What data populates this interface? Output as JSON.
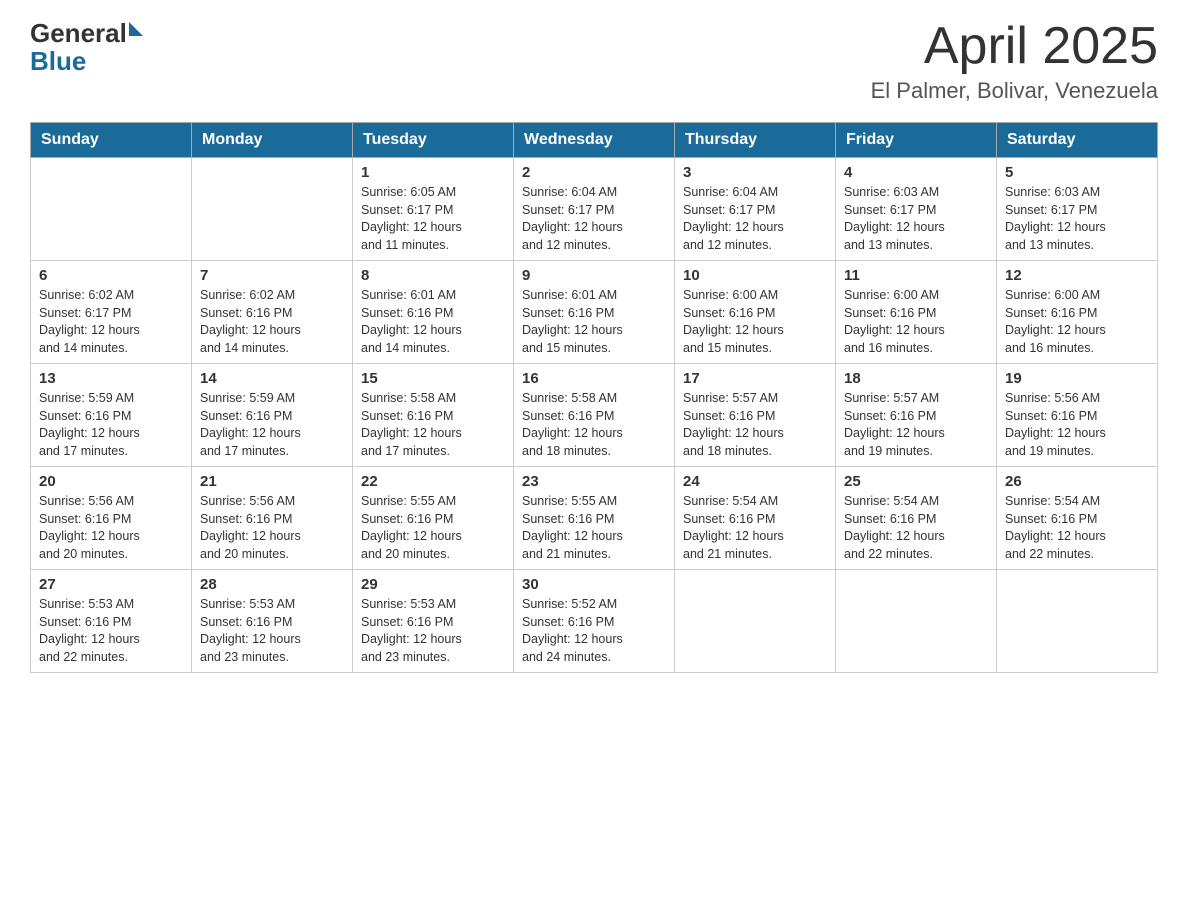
{
  "logo": {
    "general": "General",
    "blue": "Blue",
    "arrow": "▶"
  },
  "title": "April 2025",
  "subtitle": "El Palmer, Bolivar, Venezuela",
  "weekdays": [
    "Sunday",
    "Monday",
    "Tuesday",
    "Wednesday",
    "Thursday",
    "Friday",
    "Saturday"
  ],
  "weeks": [
    [
      {
        "day": "",
        "info": ""
      },
      {
        "day": "",
        "info": ""
      },
      {
        "day": "1",
        "info": "Sunrise: 6:05 AM\nSunset: 6:17 PM\nDaylight: 12 hours\nand 11 minutes."
      },
      {
        "day": "2",
        "info": "Sunrise: 6:04 AM\nSunset: 6:17 PM\nDaylight: 12 hours\nand 12 minutes."
      },
      {
        "day": "3",
        "info": "Sunrise: 6:04 AM\nSunset: 6:17 PM\nDaylight: 12 hours\nand 12 minutes."
      },
      {
        "day": "4",
        "info": "Sunrise: 6:03 AM\nSunset: 6:17 PM\nDaylight: 12 hours\nand 13 minutes."
      },
      {
        "day": "5",
        "info": "Sunrise: 6:03 AM\nSunset: 6:17 PM\nDaylight: 12 hours\nand 13 minutes."
      }
    ],
    [
      {
        "day": "6",
        "info": "Sunrise: 6:02 AM\nSunset: 6:17 PM\nDaylight: 12 hours\nand 14 minutes."
      },
      {
        "day": "7",
        "info": "Sunrise: 6:02 AM\nSunset: 6:16 PM\nDaylight: 12 hours\nand 14 minutes."
      },
      {
        "day": "8",
        "info": "Sunrise: 6:01 AM\nSunset: 6:16 PM\nDaylight: 12 hours\nand 14 minutes."
      },
      {
        "day": "9",
        "info": "Sunrise: 6:01 AM\nSunset: 6:16 PM\nDaylight: 12 hours\nand 15 minutes."
      },
      {
        "day": "10",
        "info": "Sunrise: 6:00 AM\nSunset: 6:16 PM\nDaylight: 12 hours\nand 15 minutes."
      },
      {
        "day": "11",
        "info": "Sunrise: 6:00 AM\nSunset: 6:16 PM\nDaylight: 12 hours\nand 16 minutes."
      },
      {
        "day": "12",
        "info": "Sunrise: 6:00 AM\nSunset: 6:16 PM\nDaylight: 12 hours\nand 16 minutes."
      }
    ],
    [
      {
        "day": "13",
        "info": "Sunrise: 5:59 AM\nSunset: 6:16 PM\nDaylight: 12 hours\nand 17 minutes."
      },
      {
        "day": "14",
        "info": "Sunrise: 5:59 AM\nSunset: 6:16 PM\nDaylight: 12 hours\nand 17 minutes."
      },
      {
        "day": "15",
        "info": "Sunrise: 5:58 AM\nSunset: 6:16 PM\nDaylight: 12 hours\nand 17 minutes."
      },
      {
        "day": "16",
        "info": "Sunrise: 5:58 AM\nSunset: 6:16 PM\nDaylight: 12 hours\nand 18 minutes."
      },
      {
        "day": "17",
        "info": "Sunrise: 5:57 AM\nSunset: 6:16 PM\nDaylight: 12 hours\nand 18 minutes."
      },
      {
        "day": "18",
        "info": "Sunrise: 5:57 AM\nSunset: 6:16 PM\nDaylight: 12 hours\nand 19 minutes."
      },
      {
        "day": "19",
        "info": "Sunrise: 5:56 AM\nSunset: 6:16 PM\nDaylight: 12 hours\nand 19 minutes."
      }
    ],
    [
      {
        "day": "20",
        "info": "Sunrise: 5:56 AM\nSunset: 6:16 PM\nDaylight: 12 hours\nand 20 minutes."
      },
      {
        "day": "21",
        "info": "Sunrise: 5:56 AM\nSunset: 6:16 PM\nDaylight: 12 hours\nand 20 minutes."
      },
      {
        "day": "22",
        "info": "Sunrise: 5:55 AM\nSunset: 6:16 PM\nDaylight: 12 hours\nand 20 minutes."
      },
      {
        "day": "23",
        "info": "Sunrise: 5:55 AM\nSunset: 6:16 PM\nDaylight: 12 hours\nand 21 minutes."
      },
      {
        "day": "24",
        "info": "Sunrise: 5:54 AM\nSunset: 6:16 PM\nDaylight: 12 hours\nand 21 minutes."
      },
      {
        "day": "25",
        "info": "Sunrise: 5:54 AM\nSunset: 6:16 PM\nDaylight: 12 hours\nand 22 minutes."
      },
      {
        "day": "26",
        "info": "Sunrise: 5:54 AM\nSunset: 6:16 PM\nDaylight: 12 hours\nand 22 minutes."
      }
    ],
    [
      {
        "day": "27",
        "info": "Sunrise: 5:53 AM\nSunset: 6:16 PM\nDaylight: 12 hours\nand 22 minutes."
      },
      {
        "day": "28",
        "info": "Sunrise: 5:53 AM\nSunset: 6:16 PM\nDaylight: 12 hours\nand 23 minutes."
      },
      {
        "day": "29",
        "info": "Sunrise: 5:53 AM\nSunset: 6:16 PM\nDaylight: 12 hours\nand 23 minutes."
      },
      {
        "day": "30",
        "info": "Sunrise: 5:52 AM\nSunset: 6:16 PM\nDaylight: 12 hours\nand 24 minutes."
      },
      {
        "day": "",
        "info": ""
      },
      {
        "day": "",
        "info": ""
      },
      {
        "day": "",
        "info": ""
      }
    ]
  ]
}
